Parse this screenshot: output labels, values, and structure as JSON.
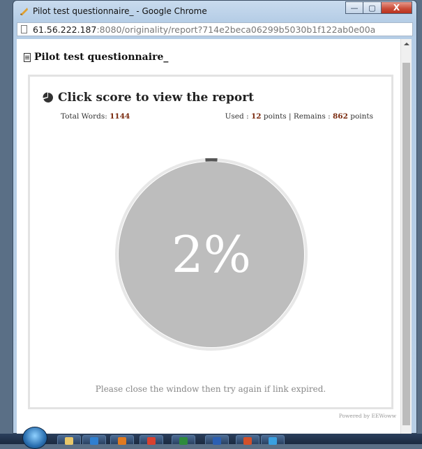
{
  "window": {
    "title": "Pilot test questionnaire_ - Google Chrome",
    "minimize_icon": "minimize-icon",
    "maximize_icon": "maximize-icon",
    "close_icon": "close-icon",
    "minimize_glyph": "—",
    "maximize_glyph": "▢",
    "close_glyph": "X"
  },
  "address": {
    "host": "61.56.222.187",
    "rest": ":8080/originality/report?714e2beca06299b5030b1f122ab0e00a"
  },
  "page": {
    "doc_title": "Pilot test questionnaire_",
    "panel_title": "Click score to view the report",
    "total_words_label": "Total Words: ",
    "total_words": "1144",
    "used_label": "Used : ",
    "used_points": "12",
    "used_suffix": " points | Remains : ",
    "remain_points": "862",
    "remain_suffix": " points",
    "score_text": "2%",
    "score_fraction": 0.02,
    "expire_note": "Please close the window then try again if link expired.",
    "powered_by": "Powered by EEWoww"
  },
  "colors": {
    "gauge_fill": "#bdbdbd",
    "gauge_ring": "#e8e8e8",
    "gauge_progress": "#555555",
    "value_color": "#7a2a0e"
  },
  "taskbar": {
    "apps": [
      {
        "icon": "folder-icon",
        "color": "#e8c76a"
      },
      {
        "icon": "outlook-icon",
        "color": "#2f7fd0"
      },
      {
        "icon": "media-player-icon",
        "color": "#e07a20"
      },
      {
        "icon": "chrome-icon",
        "color": "#d9412f"
      },
      {
        "icon": "excel-icon",
        "color": "#2e8b3d"
      },
      {
        "icon": "word-icon",
        "color": "#2b5fb3"
      },
      {
        "icon": "powerpoint-icon",
        "color": "#d2502a"
      },
      {
        "icon": "messenger-icon",
        "color": "#3aa0e0"
      }
    ]
  }
}
